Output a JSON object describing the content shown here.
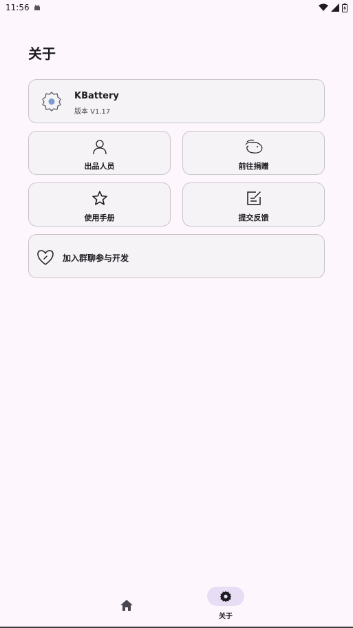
{
  "status_bar": {
    "time": "11:56"
  },
  "page": {
    "title": "关于"
  },
  "app_card": {
    "name": "KBattery",
    "version": "版本 V1.17"
  },
  "tiles": [
    {
      "label": "出品人员",
      "icon": "person-icon"
    },
    {
      "label": "前往捐赠",
      "icon": "donate-icon"
    },
    {
      "label": "使用手册",
      "icon": "star-icon"
    },
    {
      "label": "提交反馈",
      "icon": "feedback-icon"
    }
  ],
  "join": {
    "label": "加入群聊参与开发",
    "icon": "heart-icon"
  },
  "bottom_nav": {
    "about_label": "关于"
  },
  "colors": {
    "background": "#fdf7fd",
    "card": "#f5f3f6",
    "pill": "#e7def6",
    "accent": "#7a9cd3"
  }
}
